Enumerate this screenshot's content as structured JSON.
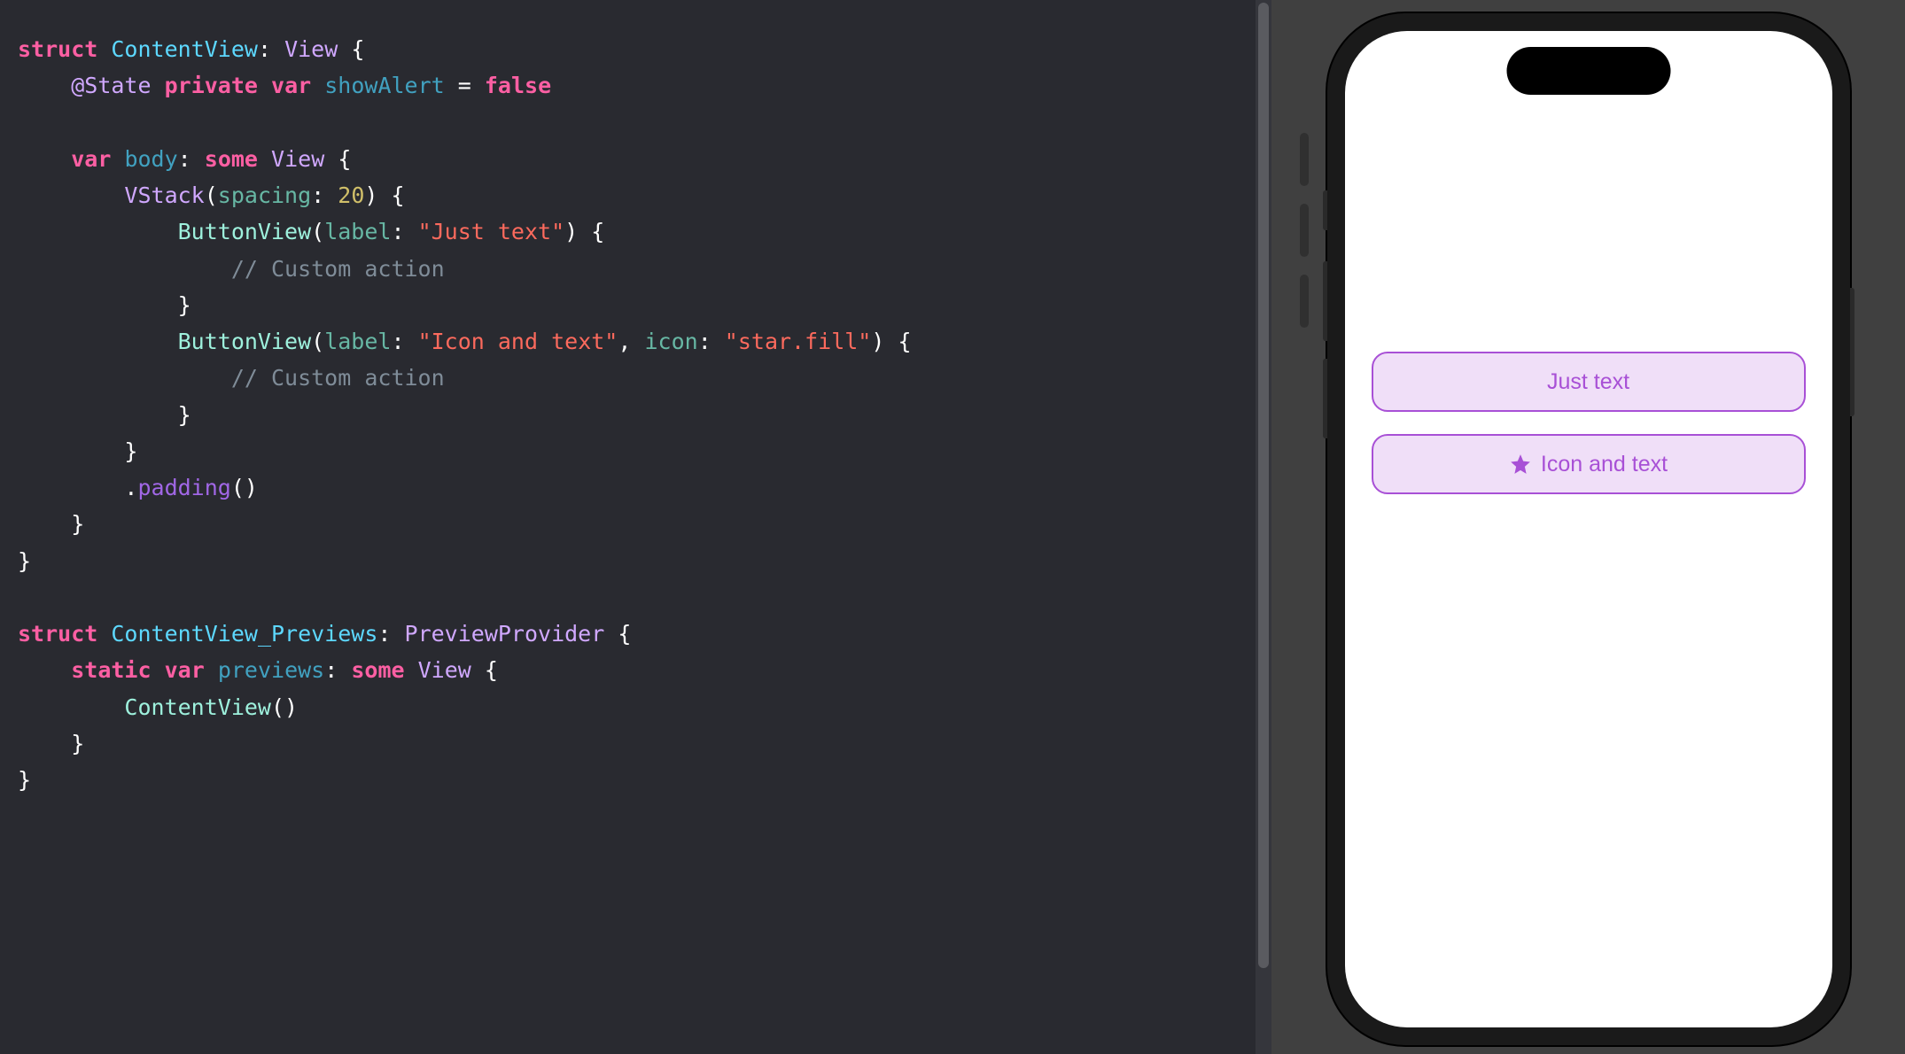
{
  "code": {
    "l1_struct": "struct",
    "l1_name": "ContentView",
    "l1_view": "View",
    "l2_state": "@State",
    "l2_private": "private",
    "l2_var": "var",
    "l2_name": "showAlert",
    "l2_false": "false",
    "l3_var": "var",
    "l3_body": "body",
    "l3_some": "some",
    "l3_view": "View",
    "l4_vstack": "VStack",
    "l4_spacing": "spacing",
    "l4_num": "20",
    "l5_button": "ButtonView",
    "l5_label": "label",
    "l5_str": "\"Just text\"",
    "l6_comment": "// Custom action",
    "l8_button": "ButtonView",
    "l8_label": "label",
    "l8_str1": "\"Icon and text\"",
    "l8_icon": "icon",
    "l8_str2": "\"star.fill\"",
    "l9_comment": "// Custom action",
    "l12_padding": "padding",
    "l16_struct": "struct",
    "l16_name": "ContentView_Previews",
    "l16_provider": "PreviewProvider",
    "l17_static": "static",
    "l17_var": "var",
    "l17_previews": "previews",
    "l17_some": "some",
    "l17_view": "View",
    "l18_content": "ContentView"
  },
  "preview": {
    "button1_label": "Just text",
    "button2_label": "Icon and text",
    "button2_icon": "star.fill"
  }
}
